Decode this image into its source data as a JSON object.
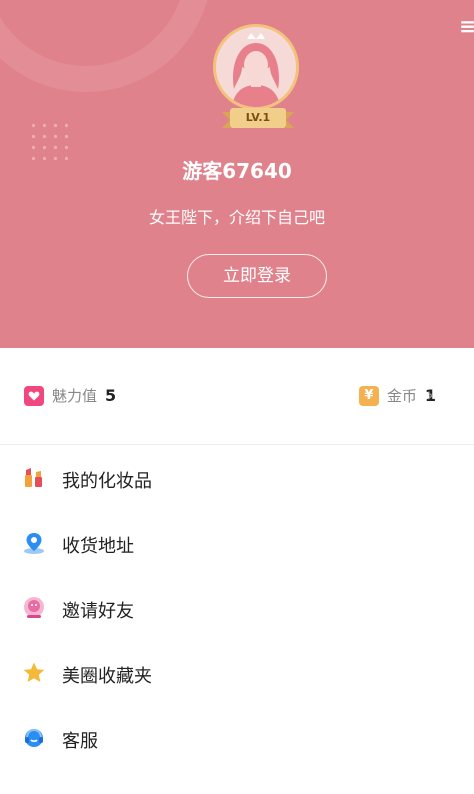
{
  "profile": {
    "username": "游客67640",
    "tagline": "女王陛下，介绍下自己吧",
    "level": "LV.1",
    "login_label": "立即登录"
  },
  "stats": {
    "charm": {
      "label": "魅力值",
      "value": "5",
      "icon": "heart-icon"
    },
    "coins": {
      "label": "金币",
      "value": "1",
      "icon": "yen-coin-icon"
    }
  },
  "menu": [
    {
      "label": "我的化妆品",
      "icon": "lipstick-icon"
    },
    {
      "label": "收货地址",
      "icon": "location-pin-icon"
    },
    {
      "label": "邀请好友",
      "icon": "invite-friend-icon"
    },
    {
      "label": "美圈收藏夹",
      "icon": "star-icon"
    },
    {
      "label": "客服",
      "icon": "headset-icon"
    }
  ],
  "colors": {
    "header_bg": "#e0828c",
    "charm_icon": "#f0477f",
    "coin_icon": "#f5b04f"
  }
}
